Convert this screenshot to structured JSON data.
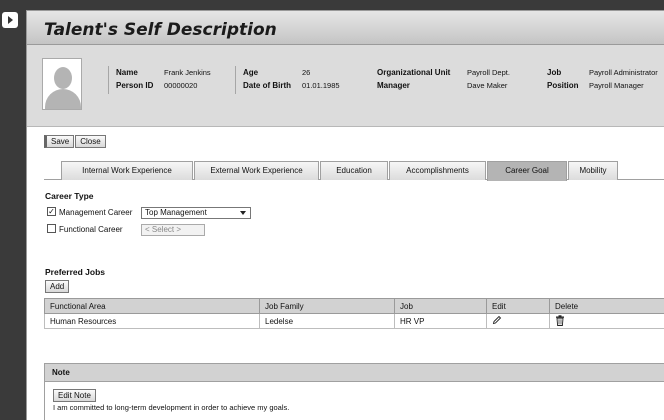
{
  "page": {
    "title": "Talent's Self Description"
  },
  "profile": {
    "name_label": "Name",
    "name_value": "Frank Jenkins",
    "person_id_label": "Person ID",
    "person_id_value": "00000020",
    "age_label": "Age",
    "age_value": "26",
    "dob_label": "Date of Birth",
    "dob_value": "01.01.1985",
    "org_unit_label": "Organizational Unit",
    "org_unit_value": "Payroll Dept.",
    "manager_label": "Manager",
    "manager_value": "Dave Maker",
    "job_label": "Job",
    "job_value": "Payroll Administrator",
    "position_label": "Position",
    "position_value": "Payroll Manager"
  },
  "toolbar": {
    "save_label": "Save",
    "close_label": "Close"
  },
  "tabs": [
    {
      "label": "Internal Work Experience"
    },
    {
      "label": "External Work Experience"
    },
    {
      "label": "Education"
    },
    {
      "label": "Accomplishments"
    },
    {
      "label": "Career Goal",
      "active": true
    },
    {
      "label": "Mobility"
    }
  ],
  "career_type": {
    "title": "Career Type",
    "management_label": "Management Career",
    "management_checked": true,
    "management_value": "Top Management",
    "functional_label": "Functional Career",
    "functional_checked": false,
    "functional_placeholder": "< Select >"
  },
  "preferred_jobs": {
    "title": "Preferred Jobs",
    "add_label": "Add",
    "columns": [
      "Functional Area",
      "Job Family",
      "Job",
      "Edit",
      "Delete"
    ],
    "rows": [
      {
        "functional_area": "Human Resources",
        "job_family": "Ledelse",
        "job": "HR VP"
      }
    ]
  },
  "note": {
    "title": "Note",
    "edit_label": "Edit Note",
    "text": "I am committed to long-term development in order to achieve my goals."
  }
}
